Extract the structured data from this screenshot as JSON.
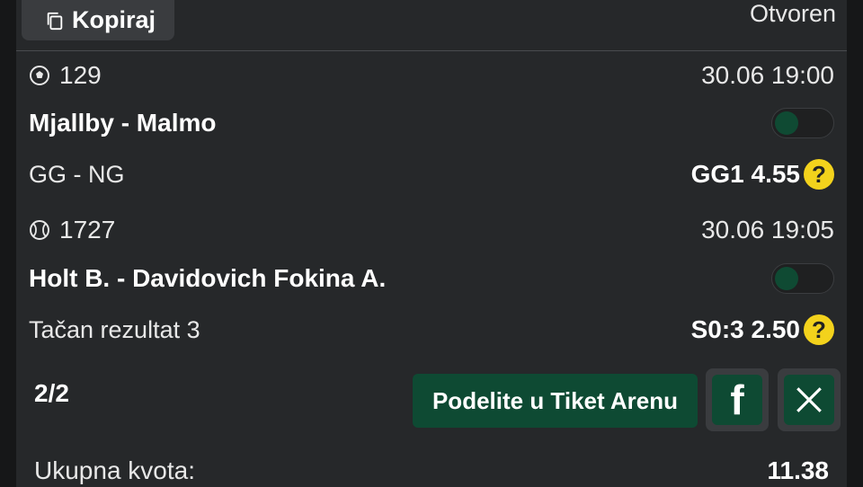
{
  "header": {
    "copy_label": "Kopiraj",
    "status": "Otvoren"
  },
  "events": [
    {
      "sport_icon": "soccer-ball-icon",
      "code": "129",
      "datetime": "30.06 19:00",
      "match": "Mjallby - Malmo",
      "market": "GG - NG",
      "pick": "GG1 4.55",
      "help": "?"
    },
    {
      "sport_icon": "tennis-ball-icon",
      "code": "1727",
      "datetime": "30.06 19:05",
      "match": "Holt B. - Davidovich Fokina A.",
      "market": "Tačan rezultat 3",
      "pick": "S0:3 2.50",
      "help": "?"
    }
  ],
  "footer": {
    "count": "2/2",
    "share_label": "Podelite u Tiket Arenu",
    "facebook_icon": "facebook-icon",
    "x_icon": "x-icon",
    "total_label": "Ukupna kvota:",
    "total_value": "11.38"
  },
  "colors": {
    "card_bg": "#26282a",
    "accent_green": "#0e4a33",
    "help_yellow": "#f3d21c"
  }
}
